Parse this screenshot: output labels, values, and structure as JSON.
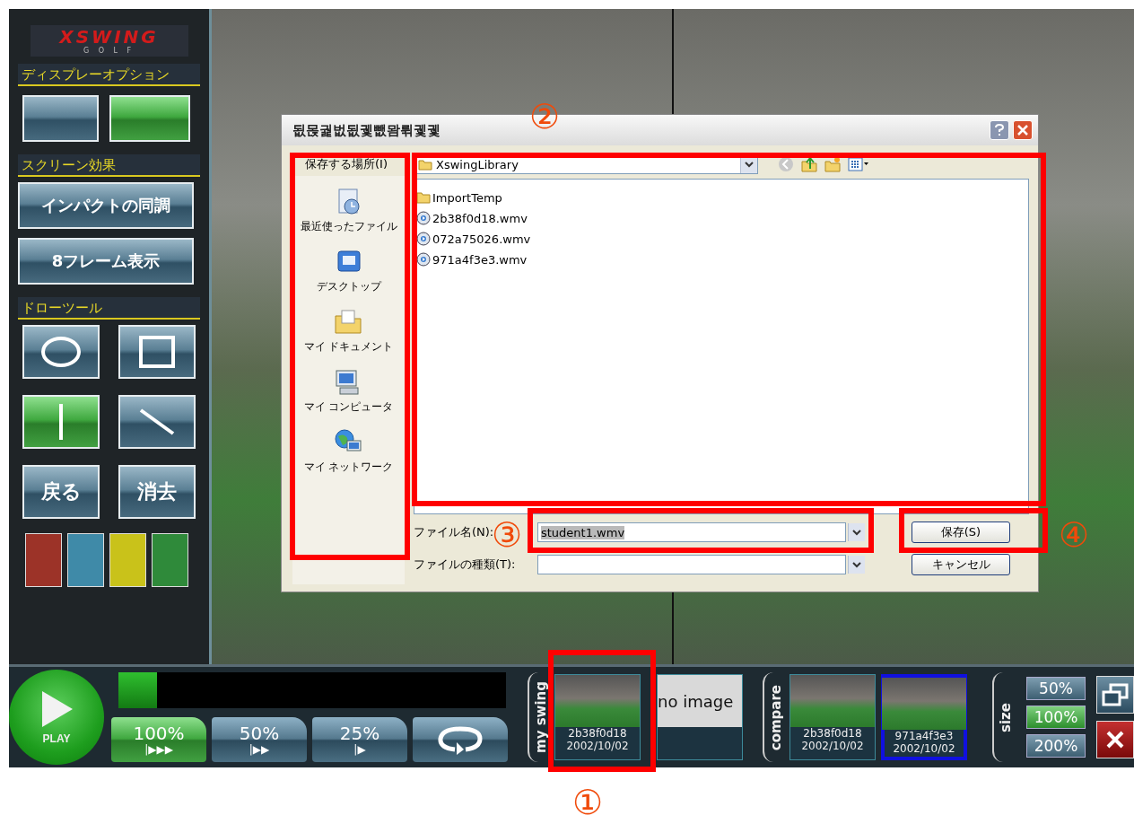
{
  "logo": {
    "main": "XSWING",
    "sub": "G O L F"
  },
  "sidebar": [
    {
      "heading": "ディスプレーオプション",
      "items": [
        {
          "kind": "single-view",
          "selected": false
        },
        {
          "kind": "split-view",
          "selected": true
        }
      ]
    },
    {
      "heading": "スクリーン効果",
      "items": [
        {
          "kind": "text",
          "label": "インパクトの同調",
          "selected": false
        },
        {
          "kind": "text",
          "label": "8フレーム表示",
          "selected": false
        }
      ]
    },
    {
      "heading": "ドローツール",
      "items": [
        {
          "kind": "circle",
          "selected": false
        },
        {
          "kind": "square",
          "selected": false
        },
        {
          "kind": "vertical-line",
          "selected": true
        },
        {
          "kind": "diagonal-line",
          "selected": false
        },
        {
          "kind": "text",
          "label": "戻る",
          "selected": false
        },
        {
          "kind": "text",
          "label": "消去",
          "selected": false
        }
      ]
    }
  ],
  "pen_colors": [
    {
      "color": "#9c3328"
    },
    {
      "color": "#3f8aa8"
    },
    {
      "color": "#c9c21a"
    },
    {
      "color": "#2f8a3a"
    }
  ],
  "dialog": {
    "title": "됪몭궕벖됪궻뺎뫔뤾궻궻",
    "location_label": "保存する場所(I)",
    "location": "XswingLibrary",
    "places": [
      {
        "kind": "recent",
        "label": "最近使ったファイル"
      },
      {
        "kind": "desktop",
        "label": "デスクトップ"
      },
      {
        "kind": "documents",
        "label": "マイ ドキュメント"
      },
      {
        "kind": "computer",
        "label": "マイ コンピュータ"
      },
      {
        "kind": "network",
        "label": "マイ ネットワーク"
      }
    ],
    "files": [
      {
        "kind": "folder",
        "name": "ImportTemp"
      },
      {
        "kind": "video",
        "name": "2b38f0d18.wmv"
      },
      {
        "kind": "video",
        "name": "072a75026.wmv"
      },
      {
        "kind": "video",
        "name": "971a4f3e3.wmv"
      }
    ],
    "filename_label": "ファイル名(N):",
    "filename": "student1.wmv",
    "filetype_label": "ファイルの種類(T):",
    "save_button": "保存(S)",
    "cancel_button": "キャンセル"
  },
  "player": {
    "play_label": "PLAY",
    "progress": {
      "level": 0.1
    },
    "speeds": [
      {
        "kind": "speed",
        "label": "100%",
        "marker": "|▶▶▶",
        "selected": true
      },
      {
        "kind": "speed",
        "label": "50%",
        "marker": "|▶▶",
        "selected": false
      },
      {
        "kind": "speed",
        "label": "25%",
        "marker": "|▶",
        "selected": false
      },
      {
        "kind": "loop",
        "selected": false
      }
    ]
  },
  "my_swing": {
    "label": "my swing",
    "thumbs": [
      {
        "kind": "photo",
        "name": "2b38f0d18",
        "date": "2002/10/02",
        "selected": false
      },
      {
        "kind": "empty",
        "text": "no image",
        "selected": false
      }
    ]
  },
  "compare": {
    "label": "compare",
    "thumbs": [
      {
        "kind": "photo",
        "name": "2b38f0d18",
        "date": "2002/10/02",
        "selected": false
      },
      {
        "kind": "photo",
        "name": "971a4f3e3",
        "date": "2002/10/02",
        "selected": true
      }
    ]
  },
  "size": {
    "label": "size",
    "options": [
      {
        "label": "50%",
        "selected": false
      },
      {
        "label": "100%",
        "selected": true
      },
      {
        "label": "200%",
        "selected": false
      }
    ]
  },
  "annotations": [
    {
      "label": "②"
    },
    {
      "label": "③"
    },
    {
      "label": "④"
    },
    {
      "label": "①"
    }
  ]
}
